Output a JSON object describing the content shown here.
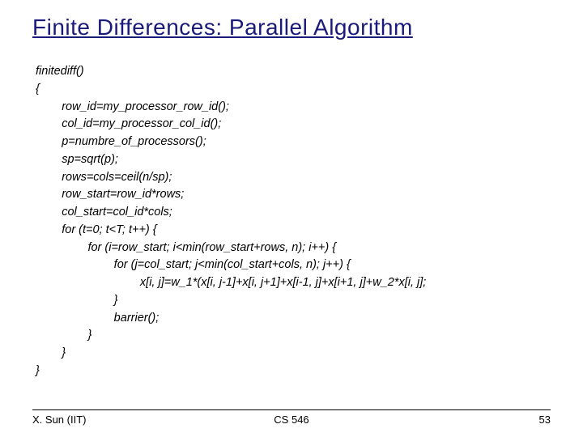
{
  "title": "Finite Differences: Parallel Algorithm",
  "code": "finitediff()\n{\n        row_id=my_processor_row_id();\n        col_id=my_processor_col_id();\n        p=numbre_of_processors();\n        sp=sqrt(p);\n        rows=cols=ceil(n/sp);\n        row_start=row_id*rows;\n        col_start=col_id*cols;\n        for (t=0; t<T; t++) {\n                for (i=row_start; i<min(row_start+rows, n); i++) {\n                        for (j=col_start; j<min(col_start+cols, n); j++) {\n                                x[i, j]=w_1*(x[i, j-1]+x[i, j+1]+x[i-1, j]+x[i+1, j]+w_2*x[i, j];\n                        }\n                        barrier();\n                }\n        }\n}",
  "footer": {
    "left": "X. Sun (IIT)",
    "center": "CS 546",
    "right": "53"
  }
}
